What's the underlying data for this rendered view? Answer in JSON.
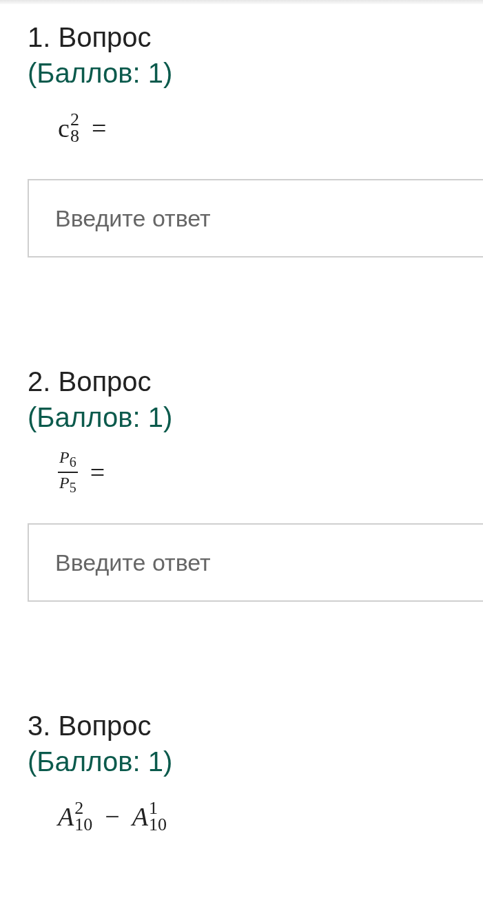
{
  "questions": [
    {
      "number": "1.",
      "title": "Вопрос",
      "points": "(Баллов: 1)",
      "formula": [
        {
          "kind": "script",
          "base": "c",
          "sup": "2",
          "sub": "8"
        },
        {
          "kind": "text",
          "text": "="
        }
      ],
      "answer": {
        "placeholder": "Введите ответ"
      }
    },
    {
      "number": "2.",
      "title": "Вопрос",
      "points": "(Баллов: 1)",
      "formula": [
        {
          "kind": "fraction",
          "num": "*P*$_{6}$",
          "den": "*P*$_{5}$"
        },
        {
          "kind": "text",
          "text": "="
        }
      ],
      "answer": {
        "placeholder": "Введите ответ"
      }
    },
    {
      "number": "3.",
      "title": "Вопрос",
      "points": "(Баллов: 1)",
      "formula": [
        {
          "kind": "script",
          "base": "*A*",
          "sup": "2",
          "sub": "10"
        },
        {
          "kind": "text",
          "text": "−"
        },
        {
          "kind": "script",
          "base": "*A*",
          "sup": "1",
          "sub": "10"
        }
      ]
    }
  ]
}
